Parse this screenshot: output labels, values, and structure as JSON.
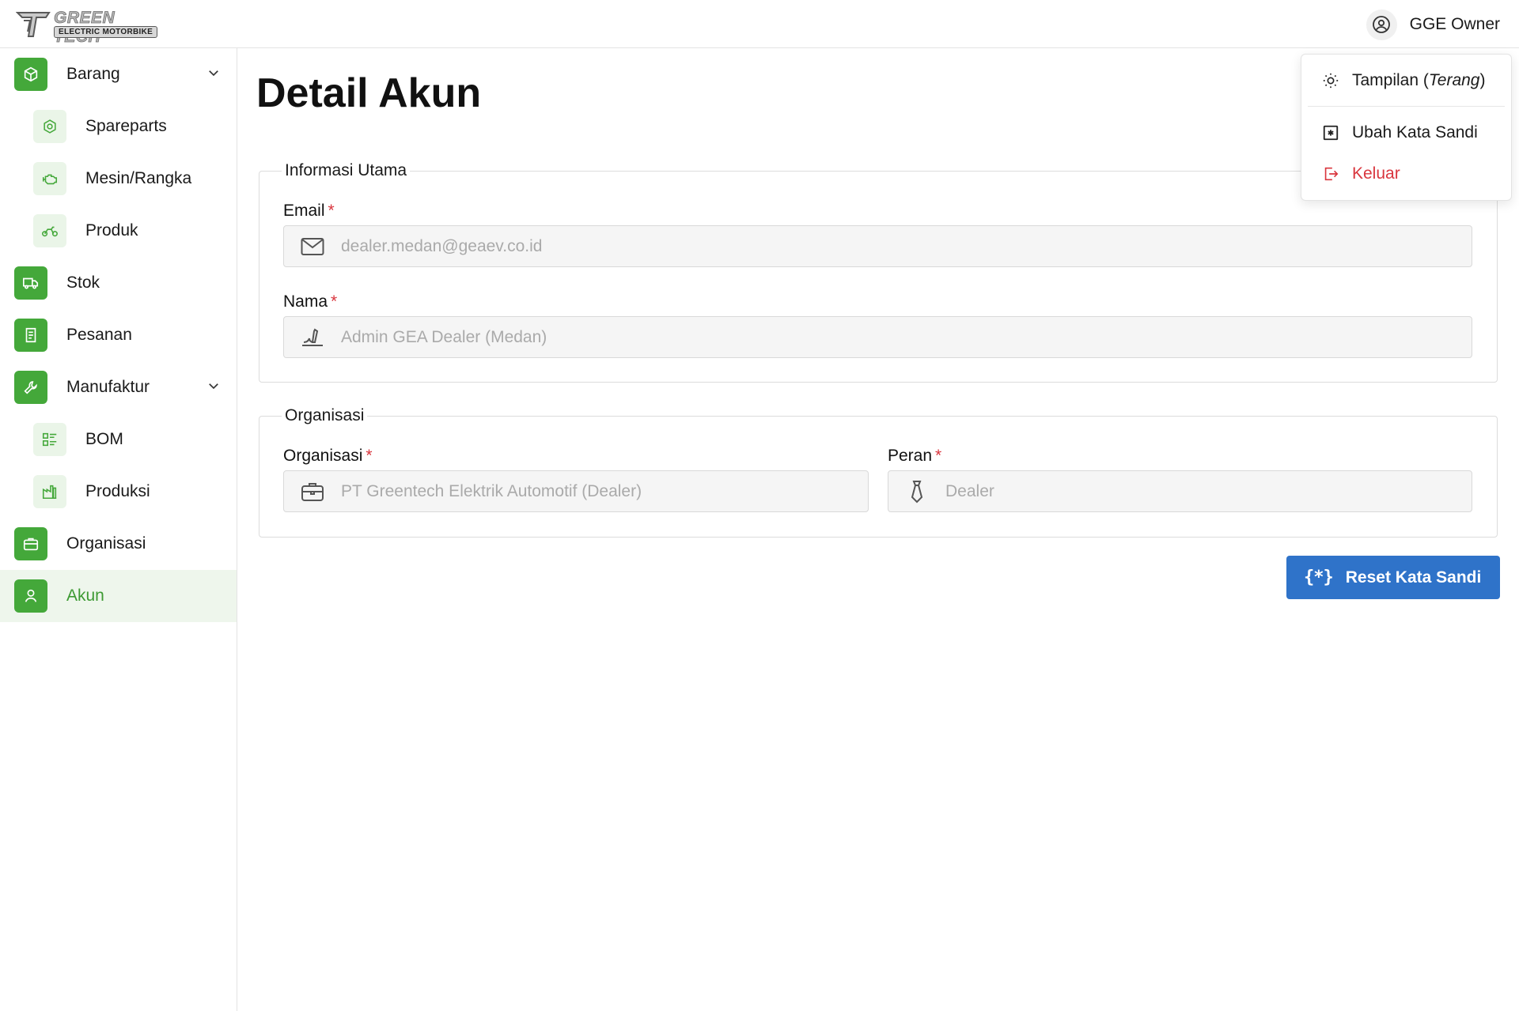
{
  "header": {
    "logo_top": "GREEN TECH",
    "logo_bottom": "ELECTRIC MOTORBIKE",
    "user_name": "GGE Owner"
  },
  "user_menu": {
    "theme_label": "Tampilan (",
    "theme_value": "Terang",
    "theme_close": ")",
    "change_password": "Ubah Kata Sandi",
    "logout": "Keluar"
  },
  "sidebar": {
    "items": [
      {
        "label": "Barang",
        "icon": "box-icon",
        "expandable": true
      },
      {
        "label": "Spareparts",
        "icon": "nut-icon"
      },
      {
        "label": "Mesin/Rangka",
        "icon": "engine-icon"
      },
      {
        "label": "Produk",
        "icon": "motorbike-icon"
      },
      {
        "label": "Stok",
        "icon": "truck-icon"
      },
      {
        "label": "Pesanan",
        "icon": "receipt-icon"
      },
      {
        "label": "Manufaktur",
        "icon": "wrench-icon",
        "expandable": true
      },
      {
        "label": "BOM",
        "icon": "list-icon"
      },
      {
        "label": "Produksi",
        "icon": "factory-icon"
      },
      {
        "label": "Organisasi",
        "icon": "briefcase-icon"
      },
      {
        "label": "Akun",
        "icon": "user-icon",
        "active": true
      }
    ]
  },
  "page": {
    "title": "Detail Akun"
  },
  "informasi_utama": {
    "legend": "Informasi Utama",
    "email_label": "Email",
    "email_value": "dealer.medan@geaev.co.id",
    "nama_label": "Nama",
    "nama_value": "Admin GEA Dealer (Medan)"
  },
  "organisasi": {
    "legend": "Organisasi",
    "org_label": "Organisasi",
    "org_value": "PT Greentech Elektrik Automotif (Dealer)",
    "peran_label": "Peran",
    "peran_value": "Dealer"
  },
  "required_mark": "*",
  "actions": {
    "reset_icon": "{*}",
    "reset_label": "Reset Kata Sandi"
  },
  "colors": {
    "brand_green": "#44a83a",
    "primary_blue": "#2f73c9",
    "danger_red": "#d9363e"
  }
}
